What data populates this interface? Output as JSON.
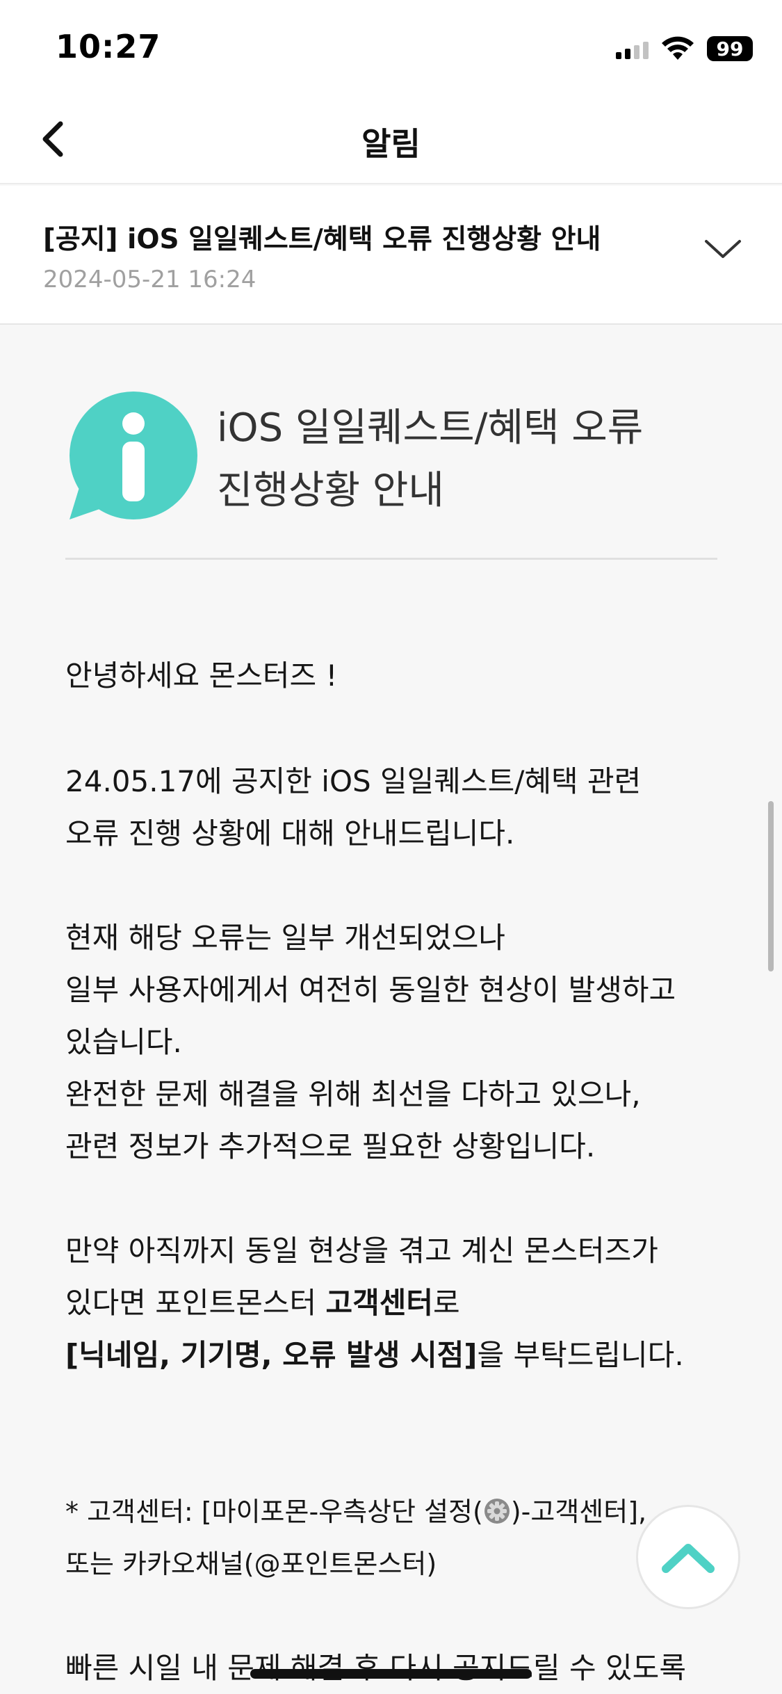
{
  "status_bar": {
    "time": "10:27",
    "battery": "99"
  },
  "nav": {
    "title": "알림"
  },
  "notice": {
    "title": "[공지] iOS 일일퀘스트/혜택 오류 진행상황 안내",
    "date": "2024-05-21 16:24"
  },
  "content": {
    "intro_title_line1": "iOS 일일퀘스트/혜택 오류",
    "intro_title_line2": "진행상황 안내",
    "greeting": "안녕하세요 몬스터즈 !",
    "p1_line1": "24.05.17에 공지한 iOS 일일퀘스트/혜택 관련",
    "p1_line2": "오류 진행 상황에 대해 안내드립니다.",
    "p2_line1": "현재 해당 오류는 일부 개선되었으나",
    "p2_line2": "일부 사용자에게서 여전히 동일한 현상이 발생하고",
    "p2_line3": "있습니다.",
    "p3_line1": "완전한 문제 해결을 위해 최선을 다하고 있으나,",
    "p3_line2": "관련 정보가 추가적으로 필요한 상황입니다.",
    "p4_line1": "만약 아직까지 동일 현상을 겪고 계신 몬스터즈가",
    "p4_line2_prefix": "있다면 포인트몬스터 ",
    "p4_line2_bold": "고객센터",
    "p4_line2_suffix": "로",
    "p4_line3_bold": "[닉네임, 기기명, 오류 발생 시점]",
    "p4_line3_suffix": "을 부탁드립니다.",
    "note_line1_prefix": "* 고객센터: [마이포몬-우측상단 설정(",
    "note_line1_suffix": ")-고객센터],",
    "note_line2": "또는 카카오채널(@포인트몬스터)",
    "p5_line1": "빠른 시일 내 문제 해결 후 다시 공지드릴 수 있도록"
  },
  "colors": {
    "accent": "#4fd1c5",
    "date_gray": "#a0a0a0",
    "background": "#f7f7f7"
  },
  "icons": [
    "back-chevron-icon",
    "chevron-down-icon",
    "info-bubble-icon",
    "gear-icon",
    "chevron-up-icon",
    "wifi-icon",
    "signal-icon"
  ]
}
